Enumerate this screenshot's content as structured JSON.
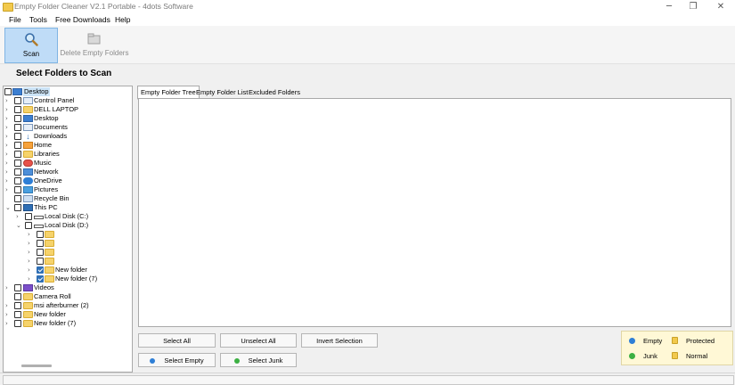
{
  "window": {
    "title": "Empty Folder Cleaner V2.1 Portable - 4dots Software",
    "controls": {
      "minimize": "─",
      "maximize": "❐",
      "close": "✕"
    }
  },
  "menu": [
    "File",
    "Tools",
    "Free Downloads",
    "Help"
  ],
  "toolbar": {
    "scan_label": "Scan",
    "delete_label": "Delete Empty Folders"
  },
  "heading": "Select Folders to Scan",
  "tree": [
    {
      "label": "Desktop",
      "icon": "blue-folder-icon",
      "expander": "",
      "checked": false,
      "selected": true
    },
    {
      "label": "Control Panel",
      "icon": "control-panel-icon",
      "expander": "›",
      "checked": false
    },
    {
      "label": "DELL LAPTOP",
      "icon": "folder-icon",
      "expander": "›",
      "checked": false
    },
    {
      "label": "Desktop",
      "icon": "blue-folder-icon",
      "expander": "›",
      "checked": false
    },
    {
      "label": "Documents",
      "icon": "documents-icon",
      "expander": "›",
      "checked": false
    },
    {
      "label": "Downloads",
      "icon": "downloads-icon",
      "expander": "›",
      "checked": false
    },
    {
      "label": "Home",
      "icon": "home-icon",
      "expander": "›",
      "checked": false
    },
    {
      "label": "Libraries",
      "icon": "folder-icon",
      "expander": "›",
      "checked": false
    },
    {
      "label": "Music",
      "icon": "music-icon",
      "expander": "›",
      "checked": false
    },
    {
      "label": "Network",
      "icon": "network-icon",
      "expander": "›",
      "checked": false
    },
    {
      "label": "OneDrive",
      "icon": "cloud-icon",
      "expander": "›",
      "checked": false
    },
    {
      "label": "Pictures",
      "icon": "pictures-icon",
      "expander": "›",
      "checked": false
    },
    {
      "label": "Recycle Bin",
      "icon": "recycle-bin-icon",
      "expander": "",
      "checked": false
    },
    {
      "label": "This PC",
      "icon": "computer-icon",
      "expander": "⌄",
      "checked": false
    },
    {
      "label": "Local Disk (C:)",
      "icon": "drive-icon",
      "expander": "›",
      "checked": false
    },
    {
      "label": "Local Disk (D:)",
      "icon": "drive-icon",
      "expander": "⌄",
      "checked": false
    },
    {
      "label": "",
      "icon": "folder-icon",
      "expander": "›",
      "checked": false
    },
    {
      "label": "",
      "icon": "folder-icon",
      "expander": "›",
      "checked": false
    },
    {
      "label": "",
      "icon": "folder-icon",
      "expander": "›",
      "checked": false
    },
    {
      "label": "",
      "icon": "folder-icon",
      "expander": "›",
      "checked": false
    },
    {
      "label": "New folder",
      "icon": "folder-icon",
      "expander": "›",
      "checked": true
    },
    {
      "label": "New folder (7)",
      "icon": "folder-icon",
      "expander": "›",
      "checked": true
    },
    {
      "label": "Videos",
      "icon": "videos-icon",
      "expander": "›",
      "checked": false
    },
    {
      "label": "Camera Roll",
      "icon": "folder-icon",
      "expander": "",
      "checked": false
    },
    {
      "label": "msi afterburner (2)",
      "icon": "folder-icon",
      "expander": "›",
      "checked": false
    },
    {
      "label": "New folder",
      "icon": "folder-icon",
      "expander": "›",
      "checked": false
    },
    {
      "label": "New folder (7)",
      "icon": "folder-icon",
      "expander": "›",
      "checked": false
    }
  ],
  "tabs": [
    "Empty Folder Tree",
    "Empty Folder List",
    "Excluded Folders"
  ],
  "buttons": {
    "select_all": "Select All",
    "unselect_all": "Unselect All",
    "invert_selection": "Invert Selection",
    "select_empty": "Select Empty",
    "select_junk": "Select Junk"
  },
  "legend": {
    "empty": "Empty",
    "protected": "Protected",
    "junk": "Junk",
    "normal": "Normal"
  },
  "colors": {
    "empty": "#2f7fd6",
    "junk": "#3cb043",
    "accent": "#bfdcf7",
    "legend_bg": "#fff8d6"
  }
}
